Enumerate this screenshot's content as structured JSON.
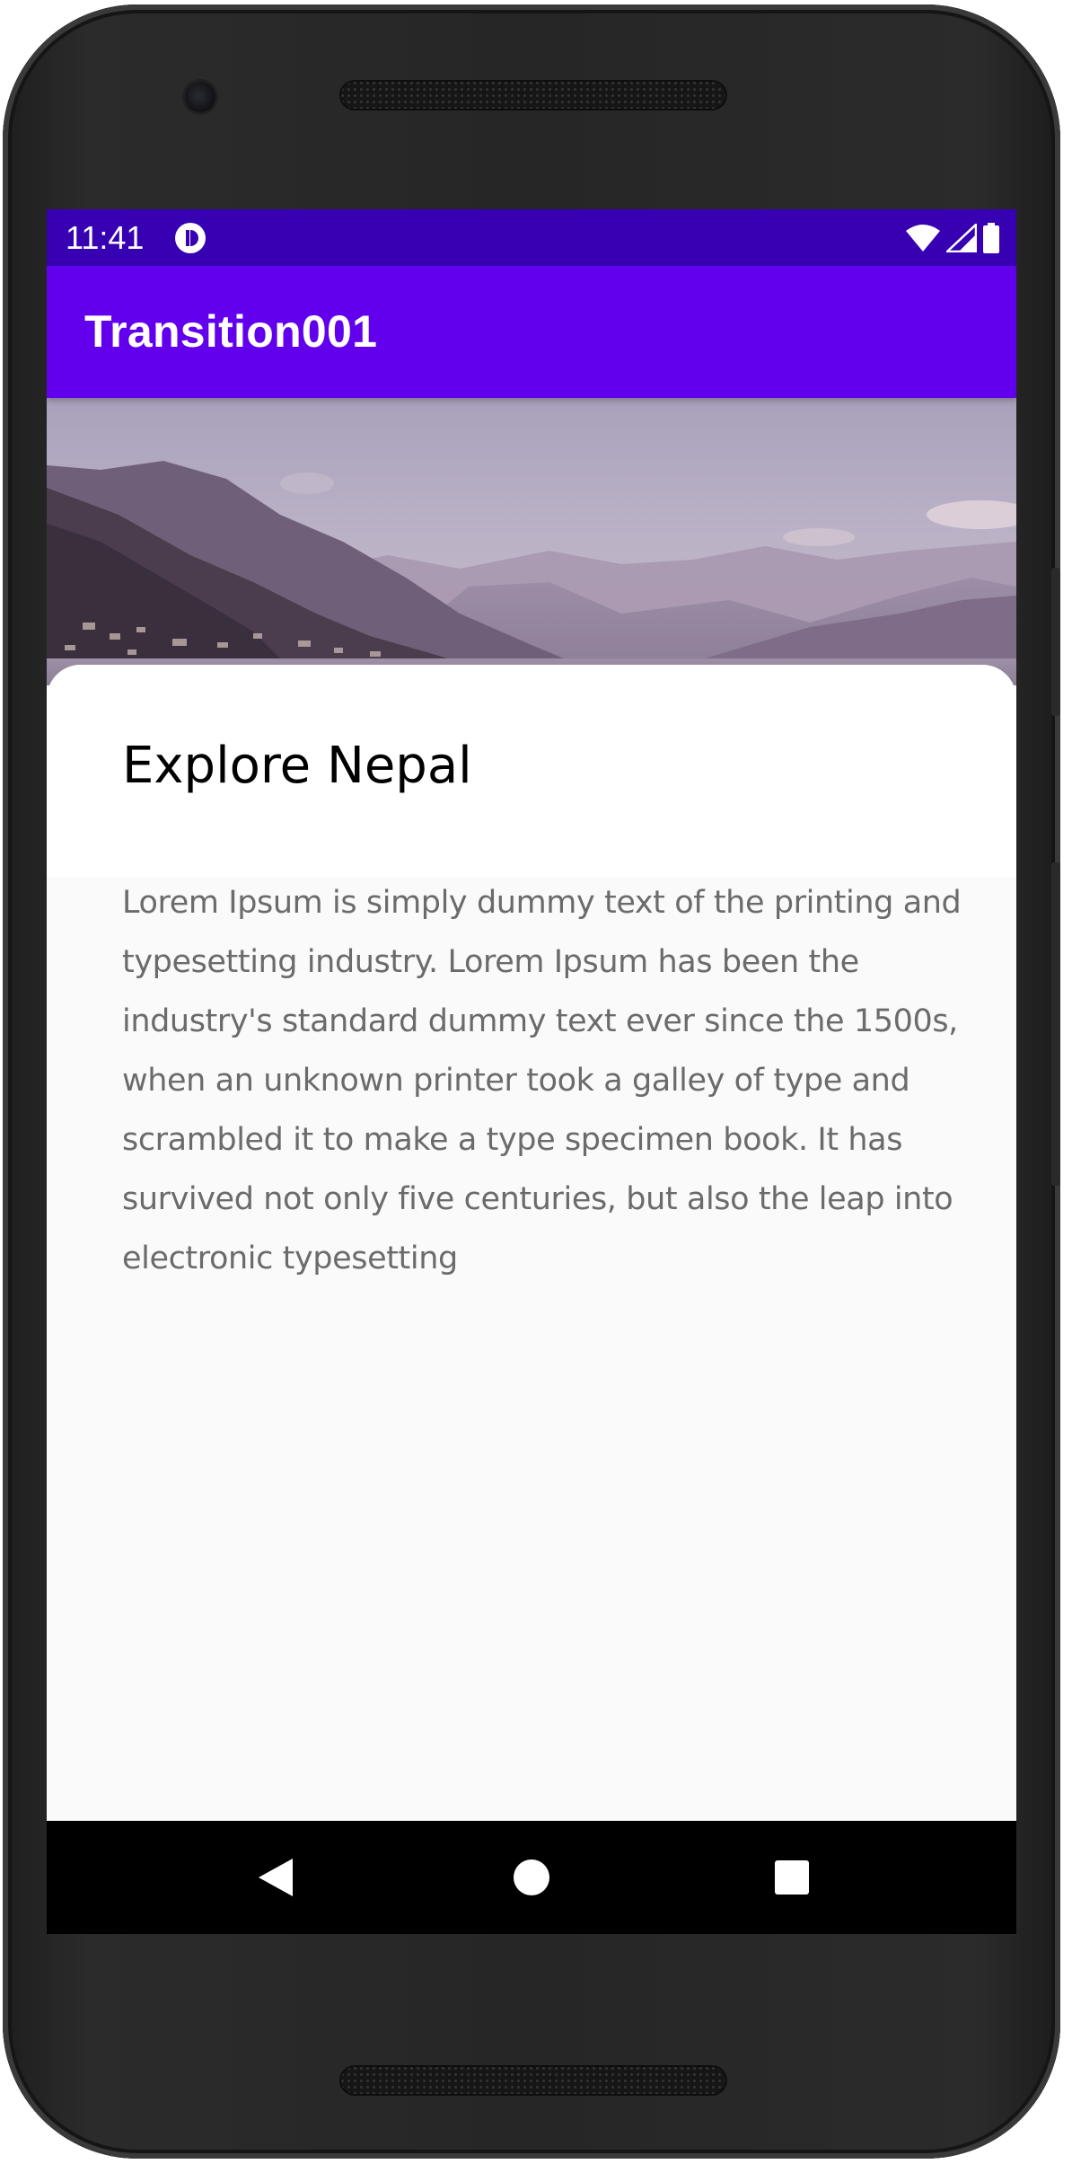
{
  "status_bar": {
    "time": "11:41",
    "icons": [
      "notification-app-icon",
      "wifi-icon",
      "signal-icon",
      "battery-icon"
    ],
    "color": "#3700b3"
  },
  "app_bar": {
    "title": "Transition001",
    "color": "#6200ee"
  },
  "hero": {
    "image": "mountain-lake-landscape"
  },
  "card": {
    "title": "Explore Nepal",
    "body": "Lorem Ipsum is simply dummy text of the printing and typesetting industry. Lorem Ipsum has been the industry's standard dummy text ever since the 1500s, when an unknown printer took a galley of type and scrambled it to make a type specimen book. It has survived not only five centuries, but also the leap into electronic typesetting"
  },
  "nav_bar": {
    "buttons": [
      "back-icon",
      "home-icon",
      "recents-icon"
    ]
  }
}
